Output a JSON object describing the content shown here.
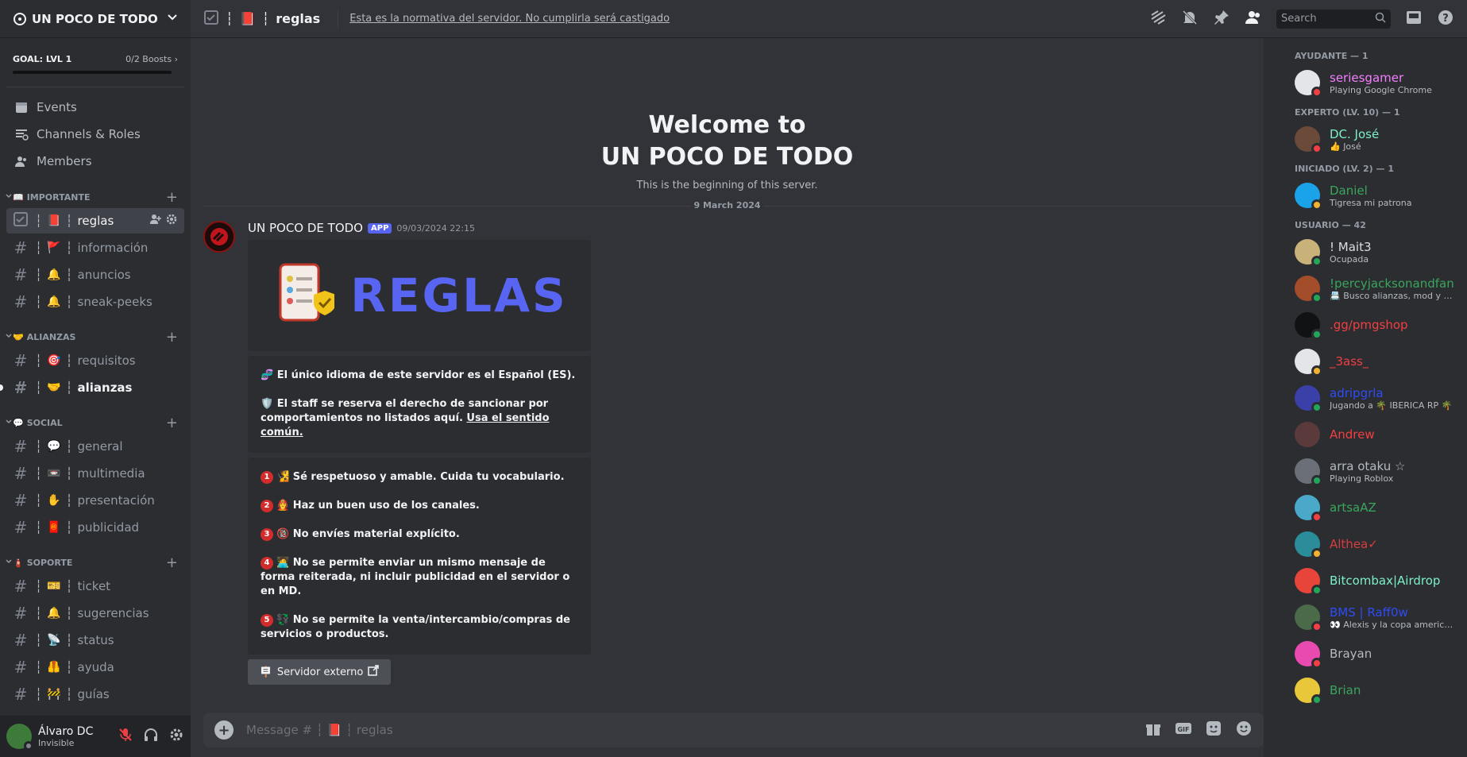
{
  "server": {
    "name": "UN POCO DE TODO",
    "boost_goal": "GOAL: LVL 1",
    "boosts": "0/2 Boosts"
  },
  "nav": {
    "events": "Events",
    "channels_roles": "Channels & Roles",
    "members": "Members"
  },
  "categories": [
    {
      "icon": "📖",
      "name": "IMPORTANTE",
      "channels": [
        {
          "emoji": "📕",
          "name": "reglas",
          "active": true
        },
        {
          "emoji": "🚩",
          "name": "información"
        },
        {
          "emoji": "🔔",
          "name": "anuncios"
        },
        {
          "emoji": "🔔",
          "name": "sneak-peeks"
        }
      ]
    },
    {
      "icon": "🤝",
      "name": "ALIANZAS",
      "channels": [
        {
          "emoji": "🎯",
          "name": "requisitos"
        },
        {
          "emoji": "🤝",
          "name": "alianzas",
          "unread": true
        }
      ]
    },
    {
      "icon": "💬",
      "name": "SOCIAL",
      "channels": [
        {
          "emoji": "💬",
          "name": "general"
        },
        {
          "emoji": "📼",
          "name": "multimedia"
        },
        {
          "emoji": "✋",
          "name": "presentación"
        },
        {
          "emoji": "🧧",
          "name": "publicidad"
        }
      ]
    },
    {
      "icon": "🧯",
      "name": "SOPORTE",
      "channels": [
        {
          "emoji": "🎫",
          "name": "ticket"
        },
        {
          "emoji": "🔔",
          "name": "sugerencias"
        },
        {
          "emoji": "📡",
          "name": "status"
        },
        {
          "emoji": "🦺",
          "name": "ayuda"
        },
        {
          "emoji": "🚧",
          "name": "guías"
        }
      ]
    }
  ],
  "user": {
    "name": "Álvaro DC",
    "status": "Invisible"
  },
  "topbar": {
    "channel_emoji": "📕",
    "channel_name": "reglas",
    "topic": "Esta es la normativa del servidor. No cumplirla será castigado",
    "search_placeholder": "Search"
  },
  "welcome": {
    "line1": "Welcome to",
    "line2": "UN POCO DE TODO",
    "sub": "This is the beginning of this server.",
    "date": "9 March 2024"
  },
  "message": {
    "author": "UN POCO DE TODO",
    "badge": "APP",
    "timestamp": "09/03/2024 22:15",
    "banner_text": "REGLAS",
    "embed1": {
      "p1": "El único idioma de este servidor es el Español (ES).",
      "p2": "El staff se reserva el derecho de sancionar por comportamientos no listados aquí.",
      "p2_link": "Usa el sentido común."
    },
    "rules": [
      {
        "n": "1",
        "emoji": "🧏",
        "text": "Sé respetuoso y amable. Cuida tu vocabulario."
      },
      {
        "n": "2",
        "emoji": "🧑‍🚒",
        "text": "Haz un buen uso de los canales."
      },
      {
        "n": "3",
        "emoji": "🔞",
        "text": "No envíes material explícito."
      },
      {
        "n": "4",
        "emoji": "🧑‍💻",
        "text": "No se permite enviar un mismo mensaje de forma reiterada, ni incluir publicidad en el servidor o en MD."
      },
      {
        "n": "5",
        "emoji": "💱",
        "text": "No se permite la venta/intercambio/compras de servicios o productos."
      }
    ],
    "button": "Servidor externo"
  },
  "composer": {
    "placeholder": "Message # ┆ 📕 ┆ reglas"
  },
  "member_groups": [
    {
      "title": "AYUDANTE — 1",
      "members": [
        {
          "name": "seriesgamer",
          "activity": "Playing Google Chrome",
          "color": "#f47fff",
          "status": "dnd",
          "avatar": "#e3e5e8"
        }
      ]
    },
    {
      "title": "EXPERTO (LV. 10) — 1",
      "members": [
        {
          "name": "DC. José",
          "activity": "👍 José",
          "color": "#7ef0c8",
          "status": "dnd",
          "avatar": "#6b4a3a"
        }
      ]
    },
    {
      "title": "INICIADO (LV. 2) — 1",
      "members": [
        {
          "name": "Daniel",
          "activity": "Tigresa mi patrona",
          "color": "#3ba55c",
          "status": "idle",
          "avatar": "#1aa3e8"
        }
      ]
    },
    {
      "title": "USUARIO — 42",
      "members": [
        {
          "name": "! Mait3",
          "activity": "Ocupada",
          "color": "#dbdee1",
          "status": "mobile",
          "avatar": "#c9b27a"
        },
        {
          "name": "!percyjacksonandfans",
          "activity": "📇 Busco alianzas, mod y caz...",
          "color": "#3ba55c",
          "status": "online",
          "avatar": "#a44d2a"
        },
        {
          "name": ".gg/pmgshop",
          "activity": "",
          "color": "#f23f43",
          "status": "online",
          "avatar": "#111214"
        },
        {
          "name": "_3ass_",
          "activity": "",
          "color": "#f23f43",
          "status": "idle",
          "avatar": "#e3e5e8"
        },
        {
          "name": "adripgrla",
          "activity": "Jugando a 🌴 IBERICA RP 🌴",
          "color": "#2f4cf5",
          "status": "online",
          "avatar": "#3b3fa8"
        },
        {
          "name": "Andrew",
          "activity": "",
          "color": "#f23f43",
          "status": "none",
          "avatar": "#5a3a3a"
        },
        {
          "name": "arra otaku ☆",
          "activity": "Playing Roblox",
          "color": "#b5bac1",
          "status": "online",
          "avatar": "#6b6f78"
        },
        {
          "name": "artsaAZ",
          "activity": "",
          "color": "#3ba55c",
          "status": "dnd",
          "avatar": "#4aa8c8"
        },
        {
          "name": "Althea✓",
          "activity": "",
          "color": "#d83c3e",
          "status": "idle",
          "avatar": "#2b8c9a"
        },
        {
          "name": "Bitcombax|Airdrop",
          "activity": "",
          "color": "#7ef0c8",
          "status": "online",
          "avatar": "#e8453a"
        },
        {
          "name": "BMS | Raff0w",
          "activity": "👀 Alexis y la copa america A...",
          "color": "#2f4cf5",
          "status": "dnd",
          "avatar": "#4a6a4a"
        },
        {
          "name": "Brayan",
          "activity": "",
          "color": "#b5bac1",
          "status": "dnd",
          "avatar": "#e84ab0"
        },
        {
          "name": "Brian",
          "activity": "",
          "color": "#3ba55c",
          "status": "online",
          "avatar": "#e8c83a"
        }
      ]
    }
  ],
  "status_colors": {
    "online": "#23a55a",
    "idle": "#f0b232",
    "dnd": "#f23f43",
    "offline": "#80848e",
    "mobile": "#23a55a"
  }
}
